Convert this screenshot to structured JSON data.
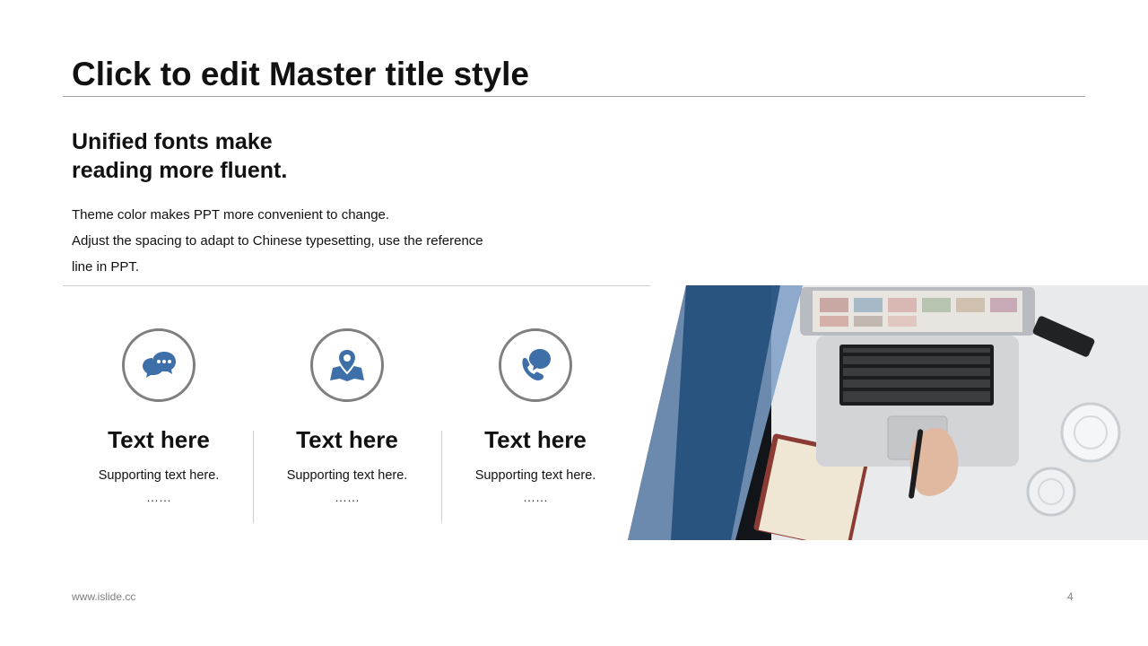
{
  "slide": {
    "title": "Click to edit Master title style",
    "subheading": [
      "Unified fonts make",
      "reading more fluent."
    ],
    "body_lines": [
      "Theme color makes PPT more convenient to change.",
      "Adjust the spacing to adapt to Chinese typesetting, use the reference",
      "line in PPT."
    ],
    "features": [
      {
        "icon": "chat-bubbles-icon",
        "title": "Text here",
        "subtitle": "Supporting text here.",
        "ellipsis": "……"
      },
      {
        "icon": "map-pin-icon",
        "title": "Text here",
        "subtitle": "Supporting text here.",
        "ellipsis": "……"
      },
      {
        "icon": "phone-chat-icon",
        "title": "Text here",
        "subtitle": "Supporting text here.",
        "ellipsis": "……"
      }
    ],
    "photo": "laptop-desk-photo",
    "footer_url": "www.islide.cc",
    "page_number": "4"
  },
  "colors": {
    "accent": "#3e6fa8",
    "accent_dark": "#1f3f66",
    "accent_light": "#7d9fc8",
    "circle_border": "#7f7f7f",
    "rule": "#a6a6a6"
  }
}
